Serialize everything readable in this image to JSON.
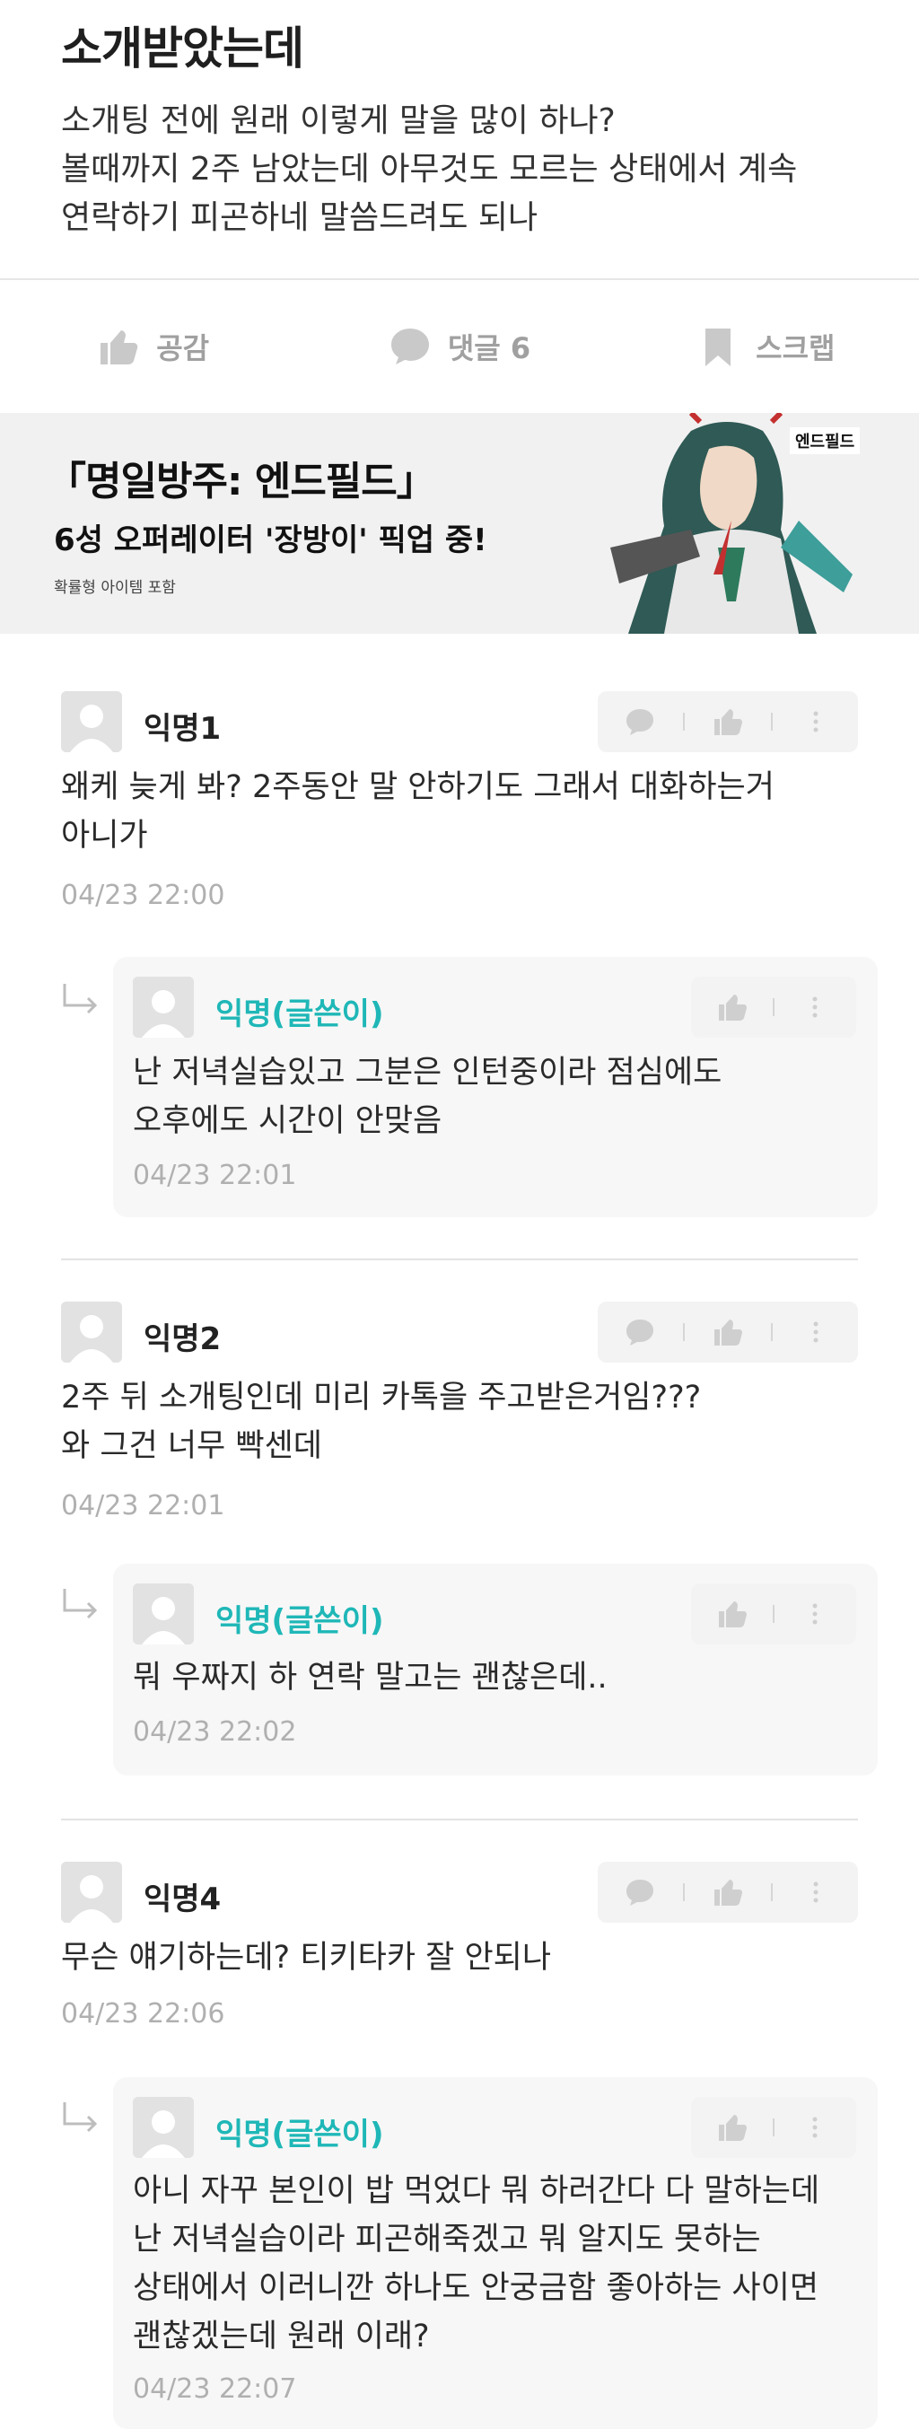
{
  "post": {
    "title": "소개받았는데",
    "body_lines": [
      "소개팅 전에 원래 이렇게 말을 많이 하나?",
      "볼때까지 2주 남았는데 아무것도 모르는 상태에서 계속",
      "연락하기 피곤하네 말씀드려도 되나"
    ]
  },
  "actions": {
    "like_label": "공감",
    "comment_label": "댓글 6",
    "scrap_label": "스크랩"
  },
  "ad": {
    "title": "「명일방주: 엔드필드」",
    "subtitle": "6성 오퍼레이터 '장방이' 픽업 중!",
    "note": "확률형 아이템 포함",
    "logo_text": "엔드필드"
  },
  "comments": [
    {
      "name": "익명1",
      "lines": [
        "왜케 늦게 봐? 2주동안 말 안하기도 그래서 대화하는거",
        "아니가"
      ],
      "date": "04/23 22:00",
      "reply": {
        "name": "익명(글쓴이)",
        "lines": [
          "난 저녁실습있고 그분은 인턴중이라 점심에도",
          "오후에도 시간이 안맞음"
        ],
        "date": "04/23 22:01"
      }
    },
    {
      "name": "익명2",
      "lines": [
        "2주 뒤 소개팅인데 미리 카톡을 주고받은거임???",
        "와 그건 너무 빡센데"
      ],
      "date": "04/23 22:01",
      "reply": {
        "name": "익명(글쓴이)",
        "lines": [
          "뭐 우짜지 하 연락 말고는 괜찮은데.."
        ],
        "date": "04/23 22:02"
      }
    },
    {
      "name": "익명4",
      "lines": [
        "무슨 얘기하는데? 티키타카 잘 안되나"
      ],
      "date": "04/23 22:06",
      "reply": {
        "name": "익명(글쓴이)",
        "lines": [
          "아니 자꾸 본인이 밥 먹었다 뭐 하러간다 다 말하는데",
          "난 저녁실습이라 피곤해죽겠고 뭐 알지도 못하는",
          "상태에서 이러니깐 하나도 안궁금함 좋아하는 사이면",
          "괜찮겠는데 원래 이래?"
        ],
        "date": "04/23 22:07"
      }
    }
  ],
  "colors": {
    "op_name": "#1fb7b7",
    "muted": "#a0a0a0",
    "date": "#b0b0b0"
  }
}
